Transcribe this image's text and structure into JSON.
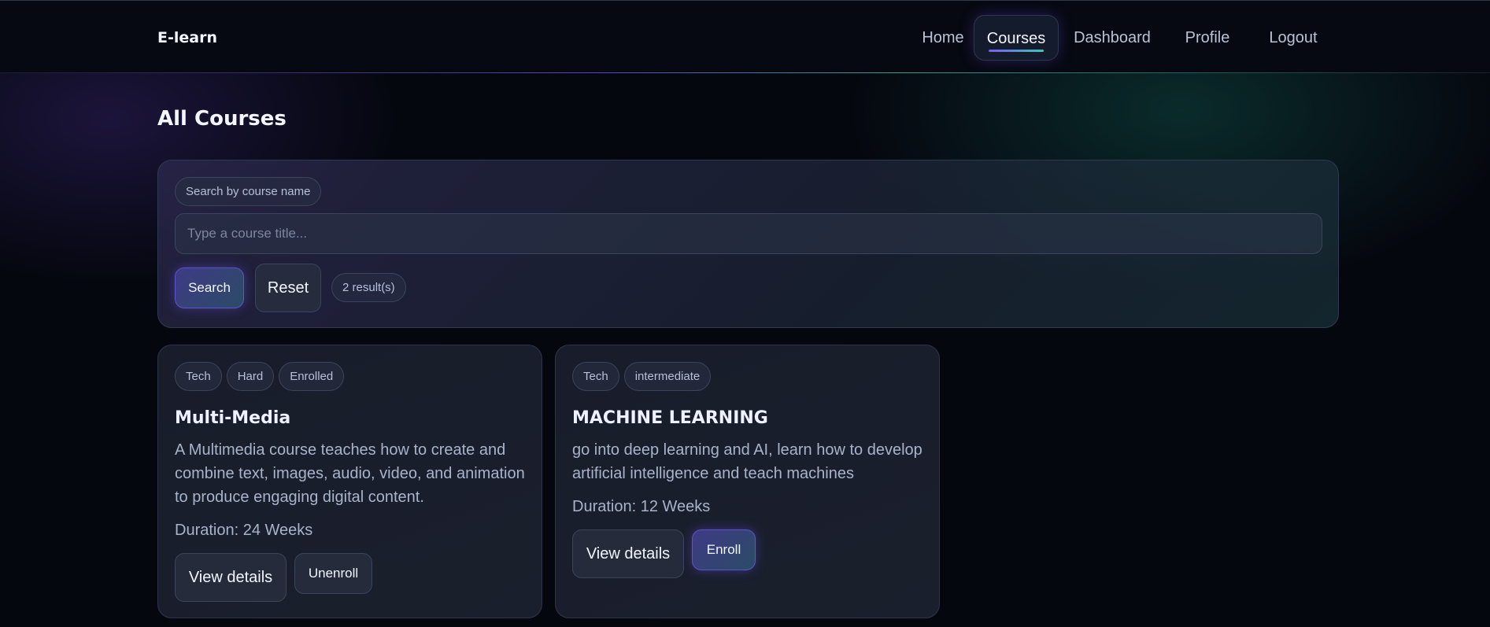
{
  "brand": "E-learn",
  "nav": {
    "items": [
      {
        "label": "Home",
        "active": false
      },
      {
        "label": "Courses",
        "active": true
      },
      {
        "label": "Dashboard",
        "active": false
      },
      {
        "label": "Profile",
        "active": false
      },
      {
        "label": "Logout",
        "active": false
      }
    ]
  },
  "page_title": "All Courses",
  "search": {
    "label": "Search by course name",
    "placeholder": "Type a course title...",
    "value": "",
    "search_button": "Search",
    "reset_button": "Reset",
    "results": "2 result(s)"
  },
  "courses": [
    {
      "tags": [
        "Tech",
        "Hard",
        "Enrolled"
      ],
      "title": "Multi-Media",
      "description": "A Multimedia course teaches how to create and combine text, images, audio, video, and animation to produce engaging digital content.",
      "duration": "Duration: 24 Weeks",
      "details_button": "View details",
      "action_button": "Unenroll"
    },
    {
      "tags": [
        "Tech",
        "intermediate"
      ],
      "title": "MACHINE LEARNING",
      "description": "go into deep learning and AI, learn how to develop artificial intelligence and teach machines",
      "duration": "Duration: 12 Weeks",
      "details_button": "View details",
      "action_button": "Enroll"
    }
  ],
  "colors": {
    "background": "#05070f",
    "accent_purple": "#7a5cf0",
    "accent_teal": "#3cc7b4"
  }
}
